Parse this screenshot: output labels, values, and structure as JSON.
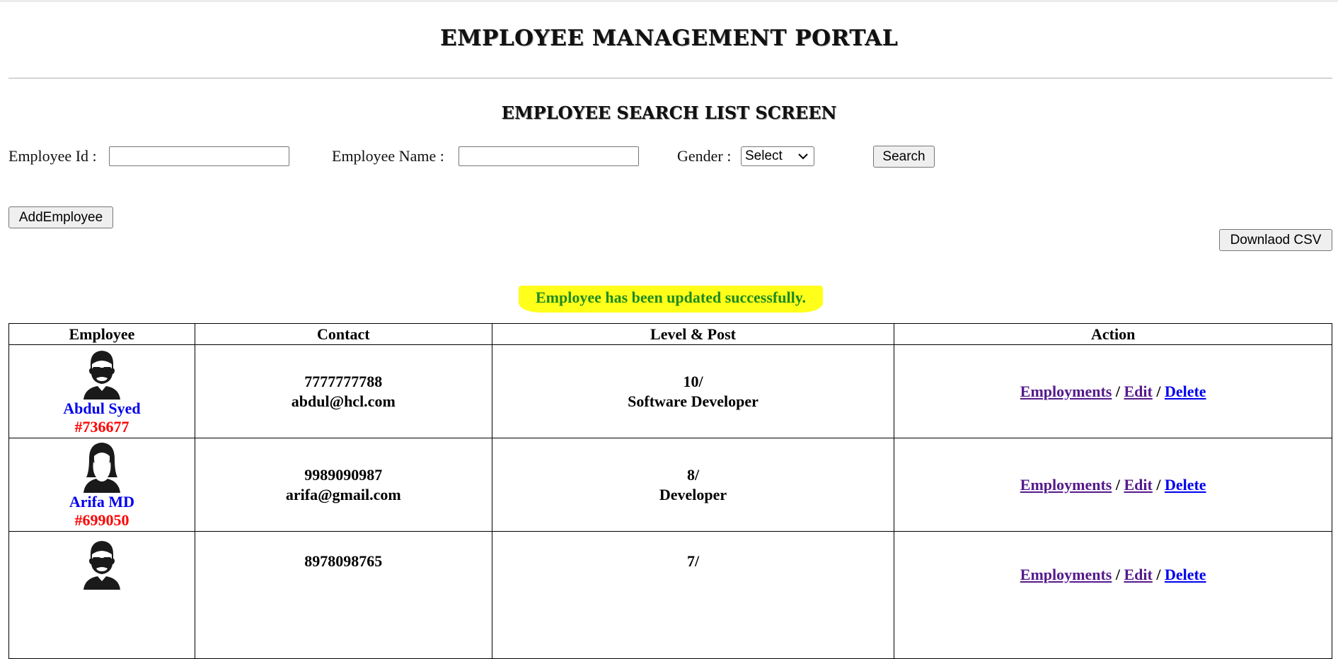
{
  "header": {
    "title": "EMPLOYEE MANAGEMENT PORTAL",
    "subtitle": "EMPLOYEE SEARCH LIST SCREEN"
  },
  "search": {
    "employee_id_label": "Employee Id :",
    "employee_id_value": "",
    "employee_name_label": "Employee Name :",
    "employee_name_value": "",
    "gender_label": "Gender :",
    "gender_selected": "Select",
    "search_button": "Search"
  },
  "actions": {
    "add_employee_button": "AddEmployee",
    "download_csv_button": "Downlaod CSV"
  },
  "message": {
    "text": "Employee has been updated successfully.",
    "color": "#1f8a1f",
    "highlight": "#ffff1a"
  },
  "table": {
    "headers": [
      "Employee",
      "Contact",
      "Level & Post",
      "Action"
    ],
    "separator": "/",
    "rows": [
      {
        "avatar": "male-avatar-icon",
        "name": "Abdul Syed",
        "id": "#736677",
        "phone": "7777777788",
        "email": "abdul@hcl.com",
        "level": "10/",
        "post": "Software Developer",
        "links": [
          "Employments",
          "Edit",
          "Delete"
        ]
      },
      {
        "avatar": "female-avatar-icon",
        "name": "Arifa MD",
        "id": "#699050",
        "phone": "9989090987",
        "email": "arifa@gmail.com",
        "level": "8/",
        "post": "Developer",
        "links": [
          "Employments",
          "Edit",
          "Delete"
        ]
      },
      {
        "avatar": "male-avatar-icon",
        "name": "",
        "id": "",
        "phone": "8978098765",
        "email": "",
        "level": "7/",
        "post": "",
        "links": [
          "Employments",
          "Edit",
          "Delete"
        ]
      }
    ]
  },
  "colors": {
    "link_visited": "#551a8b",
    "link_unvisited": "#0000ee",
    "employee_name": "#0000ee",
    "employee_id": "#ff0000"
  }
}
